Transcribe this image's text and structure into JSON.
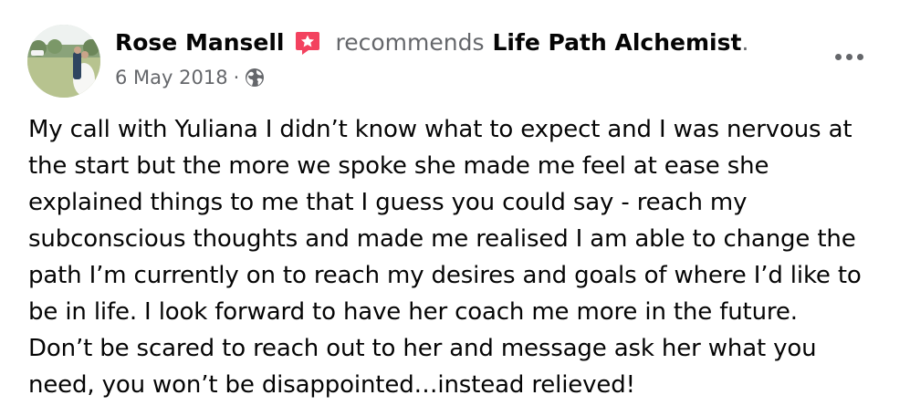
{
  "post": {
    "author": "Rose Mansell",
    "action": "recommends",
    "page": "Life Path Alchemist",
    "period": ".",
    "date": "6 May 2018",
    "separator": "·",
    "privacy_icon": "globe-icon",
    "badge_icon": "recommendation-star-icon",
    "more_icon": "more-options-icon",
    "body_lines": [
      "My call with Yuliana I didn’t know what to expect and I was nervous at",
      "the start but the more we spoke she made me feel at ease she",
      "explained things to me that I guess you could say - reach my",
      "subconscious thoughts and made me realised I am able to change the",
      "path I’m currently on to reach my desires and goals of where I’d like to",
      "be in life. I look forward to have her coach me more in the future.",
      "Don’t be scared to reach out to her and message ask her what you",
      "need, you won’t be disappointed…instead relieved!"
    ]
  },
  "colors": {
    "text_primary": "#050505",
    "text_secondary": "#65676b",
    "badge": "#f3425f",
    "background": "#ffffff"
  }
}
